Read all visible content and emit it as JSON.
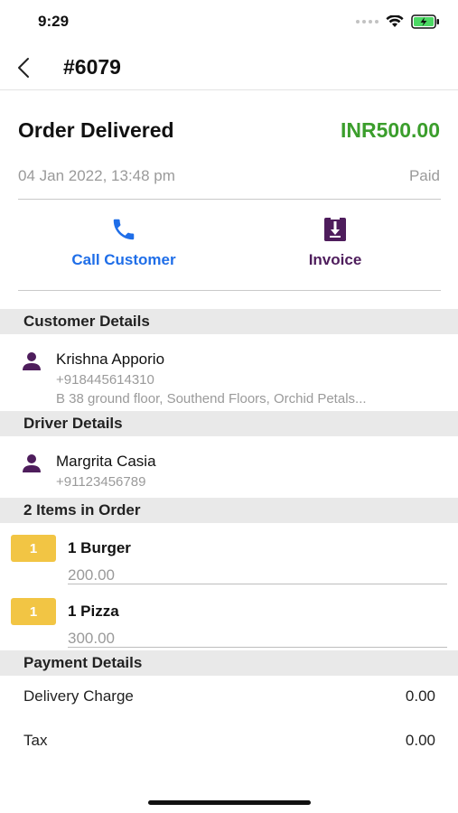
{
  "status_bar": {
    "time": "9:29"
  },
  "nav": {
    "title": "#6079"
  },
  "order": {
    "status": "Order Delivered",
    "amount": "INR500.00",
    "date": "04 Jan 2022, 13:48 pm",
    "payment_status": "Paid"
  },
  "actions": {
    "call_label": "Call Customer",
    "invoice_label": "Invoice"
  },
  "customer": {
    "header": "Customer Details",
    "name": "Krishna Apporio",
    "phone": "+918445614310",
    "address": "B 38 ground floor, Southend Floors, Orchid Petals..."
  },
  "driver": {
    "header": "Driver Details",
    "name": "Margrita Casia",
    "phone": "+91123456789"
  },
  "items": {
    "header": "2 Items in Order",
    "list": [
      {
        "qty": "1",
        "name": "1  Burger",
        "price": "200.00"
      },
      {
        "qty": "1",
        "name": "1  Pizza",
        "price": "300.00"
      }
    ]
  },
  "payment": {
    "header": "Payment Details",
    "rows": [
      {
        "label": "Delivery Charge",
        "value": "0.00"
      },
      {
        "label": "Tax",
        "value": "0.00"
      }
    ]
  },
  "colors": {
    "amount_green": "#3b9e2c",
    "call_blue": "#1f6ee8",
    "purple": "#4e1d5c",
    "badge_yellow": "#f2c544"
  }
}
